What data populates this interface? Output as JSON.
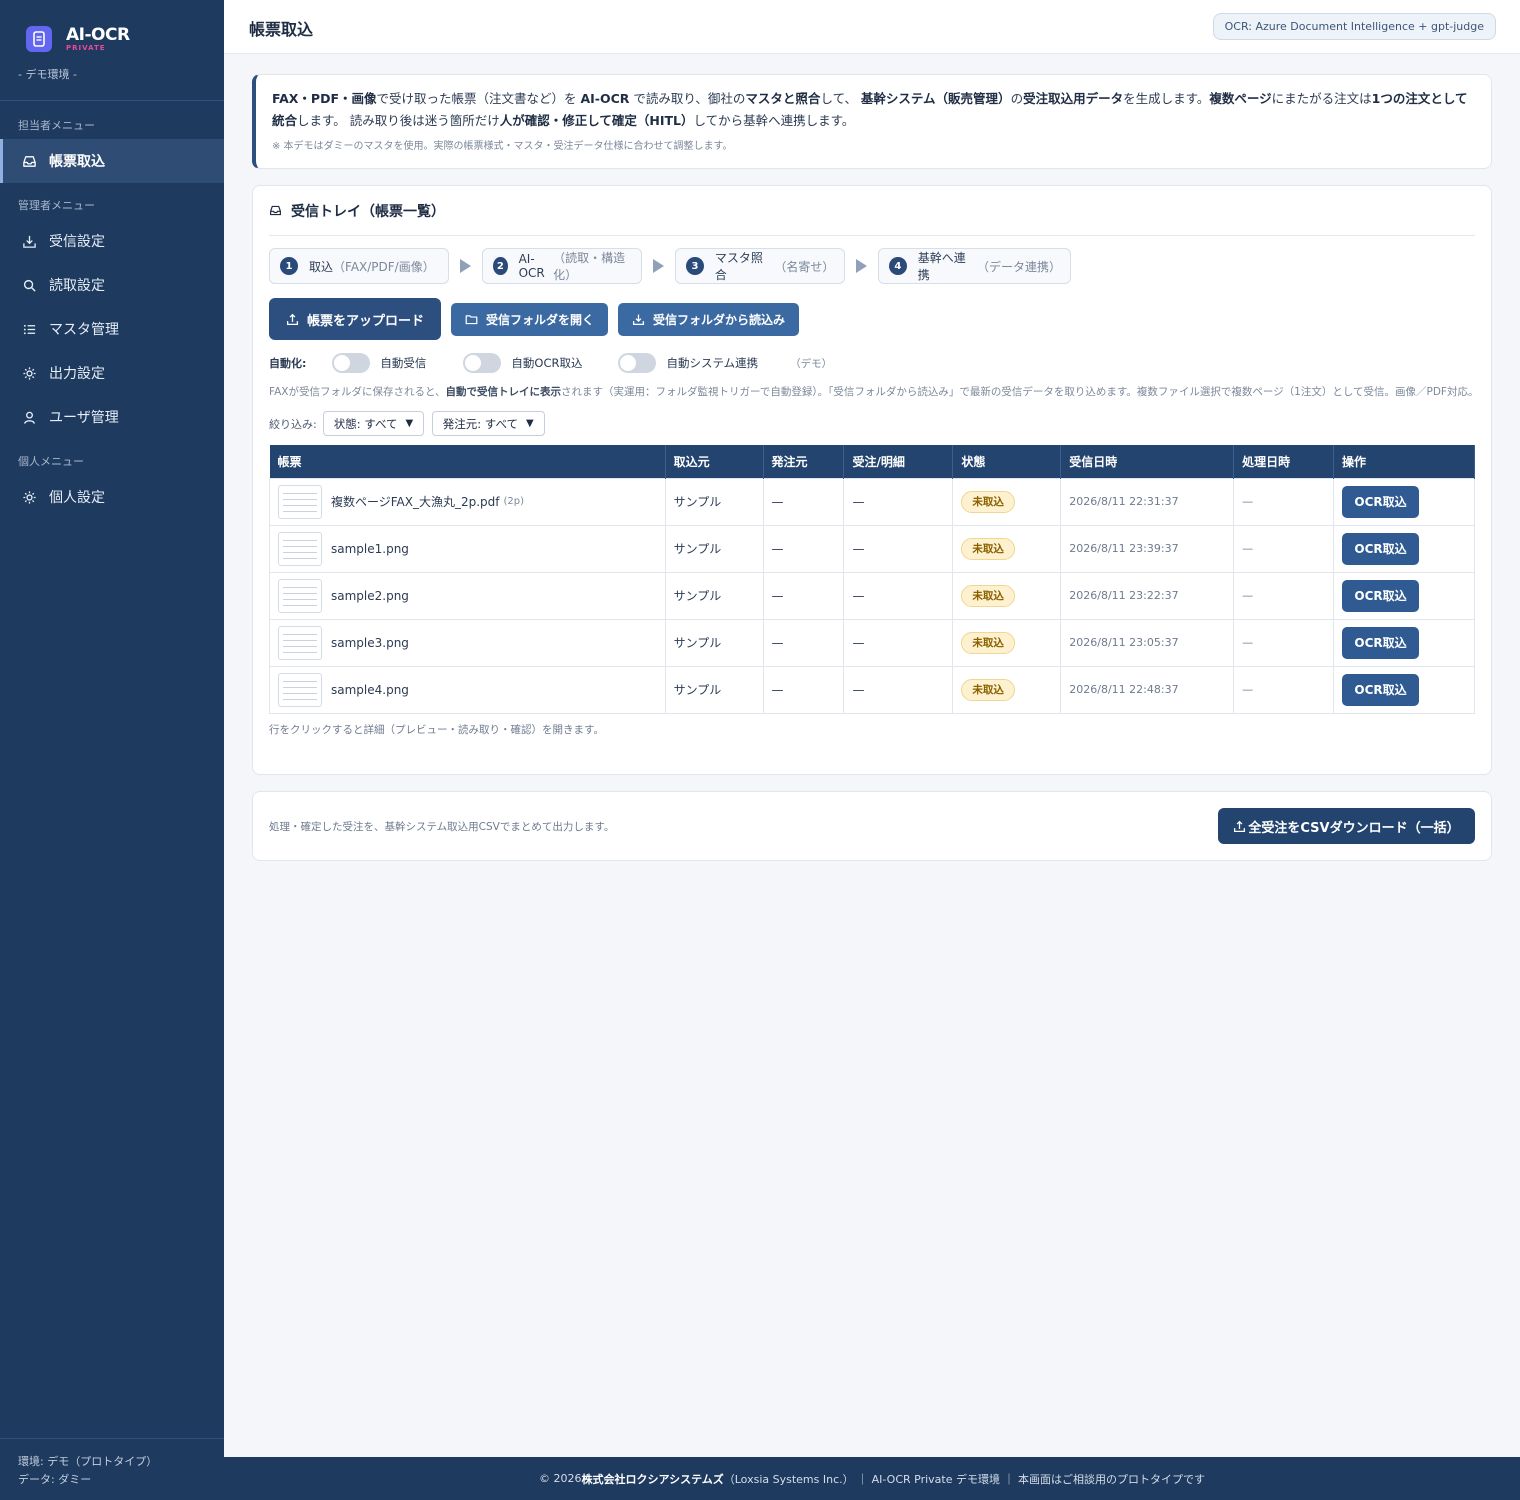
{
  "brand": {
    "name": "AI-OCR",
    "sub": "PRIVATE",
    "env": "- デモ環境 -"
  },
  "sidebar": {
    "sections": [
      {
        "heading": "担当者メニュー",
        "items": [
          {
            "label": "帳票取込",
            "icon": "inbox-icon",
            "active": true
          }
        ]
      },
      {
        "heading": "管理者メニュー",
        "items": [
          {
            "label": "受信設定",
            "icon": "download-icon"
          },
          {
            "label": "読取設定",
            "icon": "search-icon"
          },
          {
            "label": "マスタ管理",
            "icon": "list-icon"
          },
          {
            "label": "出力設定",
            "icon": "gear-icon"
          },
          {
            "label": "ユーザ管理",
            "icon": "user-icon"
          }
        ]
      },
      {
        "heading": "個人メニュー",
        "items": [
          {
            "label": "個人設定",
            "icon": "gear-icon"
          }
        ]
      }
    ],
    "footer": {
      "env": "環境: デモ（プロトタイプ）",
      "data": "データ: ダミー"
    }
  },
  "header": {
    "title": "帳票取込",
    "ocr_badge": "OCR: Azure Document Intelligence + gpt-judge"
  },
  "intro": {
    "seg1": "FAX・PDF・画像",
    "seg2": "で受け取った帳票（注文書など）を ",
    "seg3": "AI-OCR",
    "seg4": " で読み取り、御社の",
    "seg5": "マスタと照合",
    "seg6": "して、 ",
    "seg7": "基幹システム（販売管理）",
    "seg8": "の",
    "seg9": "受注取込用データ",
    "seg10": "を生成します。",
    "seg11": "複数ページ",
    "seg12": "にまたがる注文は",
    "seg13": "1つの注文として統合",
    "seg14": "します。 読み取り後は迷う箇所だけ",
    "seg15": "人が確認・修正して確定（HITL）",
    "seg16": "してから基幹へ連携します。",
    "note": "※ 本デモはダミーのマスタを使用。実際の帳票様式・マスタ・受注データ仕様に合わせて調整します。"
  },
  "tray": {
    "title": "受信トレイ（帳票一覧）",
    "steps": [
      {
        "num": "1",
        "label": "取込",
        "sub": "（FAX/PDF/画像）"
      },
      {
        "num": "2",
        "label": "AI-OCR",
        "sub": "（読取・構造化）"
      },
      {
        "num": "3",
        "label": "マスタ照合",
        "sub": "（名寄せ）"
      },
      {
        "num": "4",
        "label": "基幹へ連携",
        "sub": "（データ連携）"
      }
    ],
    "upload_label": "帳票をアップロード",
    "open_folder_label": "受信フォルダを開く",
    "read_folder_label": "受信フォルダから読込み",
    "auto": {
      "label": "自動化:",
      "toggles": [
        "自動受信",
        "自動OCR取込",
        "自動システム連携"
      ],
      "demo": "（デモ）"
    },
    "hint": {
      "a": "FAXが受信フォルダに保存されると、",
      "b": "自動で受信トレイに表示",
      "c": "されます（実運用：フォルダ監視トリガーで自動登録）。「受信フォルダから読込み」で最新の受信データを取り込めます。複数ファイル選択で複数ページ（1注文）として受信。画像／PDF対応。"
    },
    "filter": {
      "label": "絞り込み:",
      "status": "状態: すべて",
      "source": "発注元: すべて"
    },
    "columns": [
      "帳票",
      "取込元",
      "発注元",
      "受注/明細",
      "状態",
      "受信日時",
      "処理日時",
      "操作"
    ],
    "rows": [
      {
        "file": "複数ページFAX_大漁丸_2p.pdf",
        "pages": "(2p)",
        "source": "サンプル",
        "orderer": "—",
        "order": "—",
        "status": "未取込",
        "received": "2026/8/11 22:31:37",
        "processed": "—",
        "action": "OCR取込"
      },
      {
        "file": "sample1.png",
        "pages": "",
        "source": "サンプル",
        "orderer": "—",
        "order": "—",
        "status": "未取込",
        "received": "2026/8/11 23:39:37",
        "processed": "—",
        "action": "OCR取込"
      },
      {
        "file": "sample2.png",
        "pages": "",
        "source": "サンプル",
        "orderer": "—",
        "order": "—",
        "status": "未取込",
        "received": "2026/8/11 23:22:37",
        "processed": "—",
        "action": "OCR取込"
      },
      {
        "file": "sample3.png",
        "pages": "",
        "source": "サンプル",
        "orderer": "—",
        "order": "—",
        "status": "未取込",
        "received": "2026/8/11 23:05:37",
        "processed": "—",
        "action": "OCR取込"
      },
      {
        "file": "sample4.png",
        "pages": "",
        "source": "サンプル",
        "orderer": "—",
        "order": "—",
        "status": "未取込",
        "received": "2026/8/11 22:48:37",
        "processed": "—",
        "action": "OCR取込"
      }
    ],
    "note": "行をクリックすると詳細（プレビュー・読み取り・確認）を開きます。"
  },
  "export": {
    "text": "処理・確定した受注を、基幹システム取込用CSVでまとめて出力します。",
    "button": "全受注をCSVダウンロード（一括）"
  },
  "footer": {
    "prefix": "© 2026 ",
    "company": "株式会社ロクシアシステムズ",
    "suffix": "（Loxsia Systems Inc.） ｜ AI-OCR Private デモ環境 ｜ 本画面はご相談用のプロトタイプです"
  }
}
